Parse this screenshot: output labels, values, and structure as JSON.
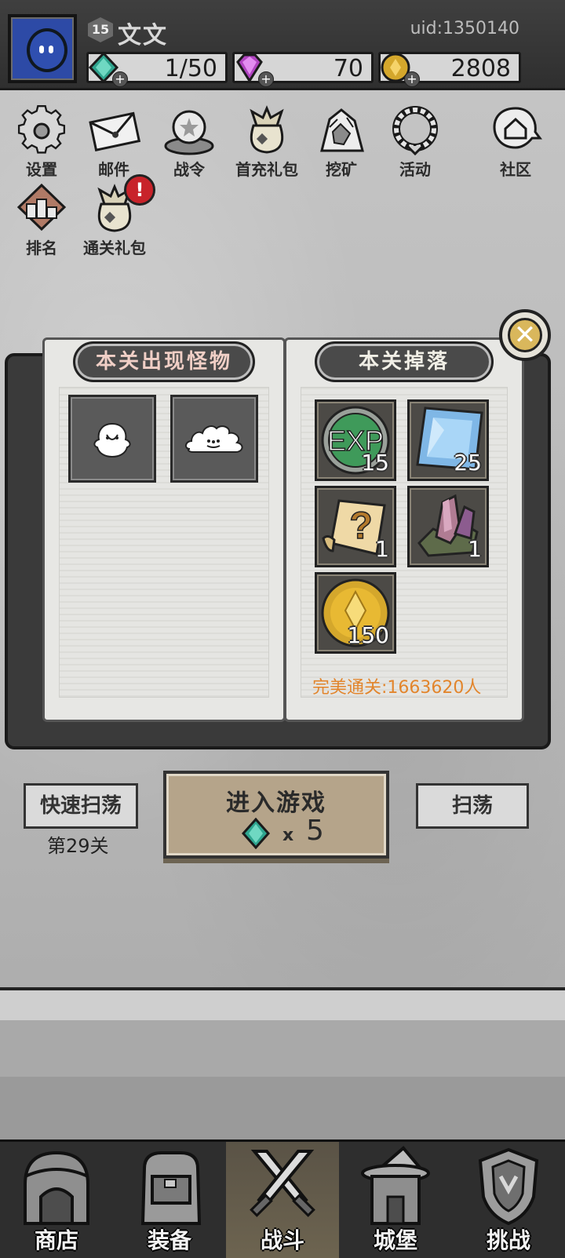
{
  "player": {
    "level": "15",
    "name": "文文",
    "uid": "uid:1350140"
  },
  "resources": {
    "stamina": "1/50",
    "gems": "70",
    "gold": "2808"
  },
  "menu": [
    {
      "label": "设置",
      "icon": "gear-icon"
    },
    {
      "label": "邮件",
      "icon": "mail-icon"
    },
    {
      "label": "战令",
      "icon": "battle-pass-icon"
    },
    {
      "label": "首充礼包",
      "icon": "first-recharge-bag-icon"
    },
    {
      "label": "挖矿",
      "icon": "mining-icon"
    },
    {
      "label": "活动",
      "icon": "event-wreath-icon"
    },
    {
      "label": "社区",
      "icon": "community-home-icon"
    },
    {
      "label": "排名",
      "icon": "ranking-icon"
    },
    {
      "label": "通关礼包",
      "icon": "clear-reward-bag-icon"
    }
  ],
  "alert_badge": "!",
  "book": {
    "left_title": "本关出现怪物",
    "right_title": "本关掉落",
    "monsters": [
      "ghost-bird-monster",
      "slime-monster"
    ],
    "drops": [
      {
        "name": "exp-icon",
        "label": "EXP",
        "qty": "15"
      },
      {
        "name": "blue-gem-icon",
        "qty": "25"
      },
      {
        "name": "mystery-scroll-icon",
        "label": "?",
        "qty": "1"
      },
      {
        "name": "crystal-ore-icon",
        "qty": "1"
      },
      {
        "name": "gold-coin-icon",
        "qty": "150"
      }
    ],
    "perfect_clear": "完美通关:1663620人"
  },
  "actions": {
    "quick_sweep": "快速扫荡",
    "stage": "第29关",
    "enter_game": "进入游戏",
    "cost_x": "x",
    "cost": "5",
    "sweep": "扫荡"
  },
  "nav": [
    {
      "label": "商店",
      "icon": "shop-icon"
    },
    {
      "label": "装备",
      "icon": "backpack-icon"
    },
    {
      "label": "战斗",
      "icon": "crossed-swords-icon",
      "active": true
    },
    {
      "label": "城堡",
      "icon": "castle-icon"
    },
    {
      "label": "挑战",
      "icon": "challenge-shield-icon"
    }
  ],
  "colors": {
    "accent_orange": "#e2852c",
    "gem_teal": "#2fa58f",
    "gem_purple": "#b043c0",
    "gold": "#d4a72c",
    "alert_red": "#c8232a"
  }
}
